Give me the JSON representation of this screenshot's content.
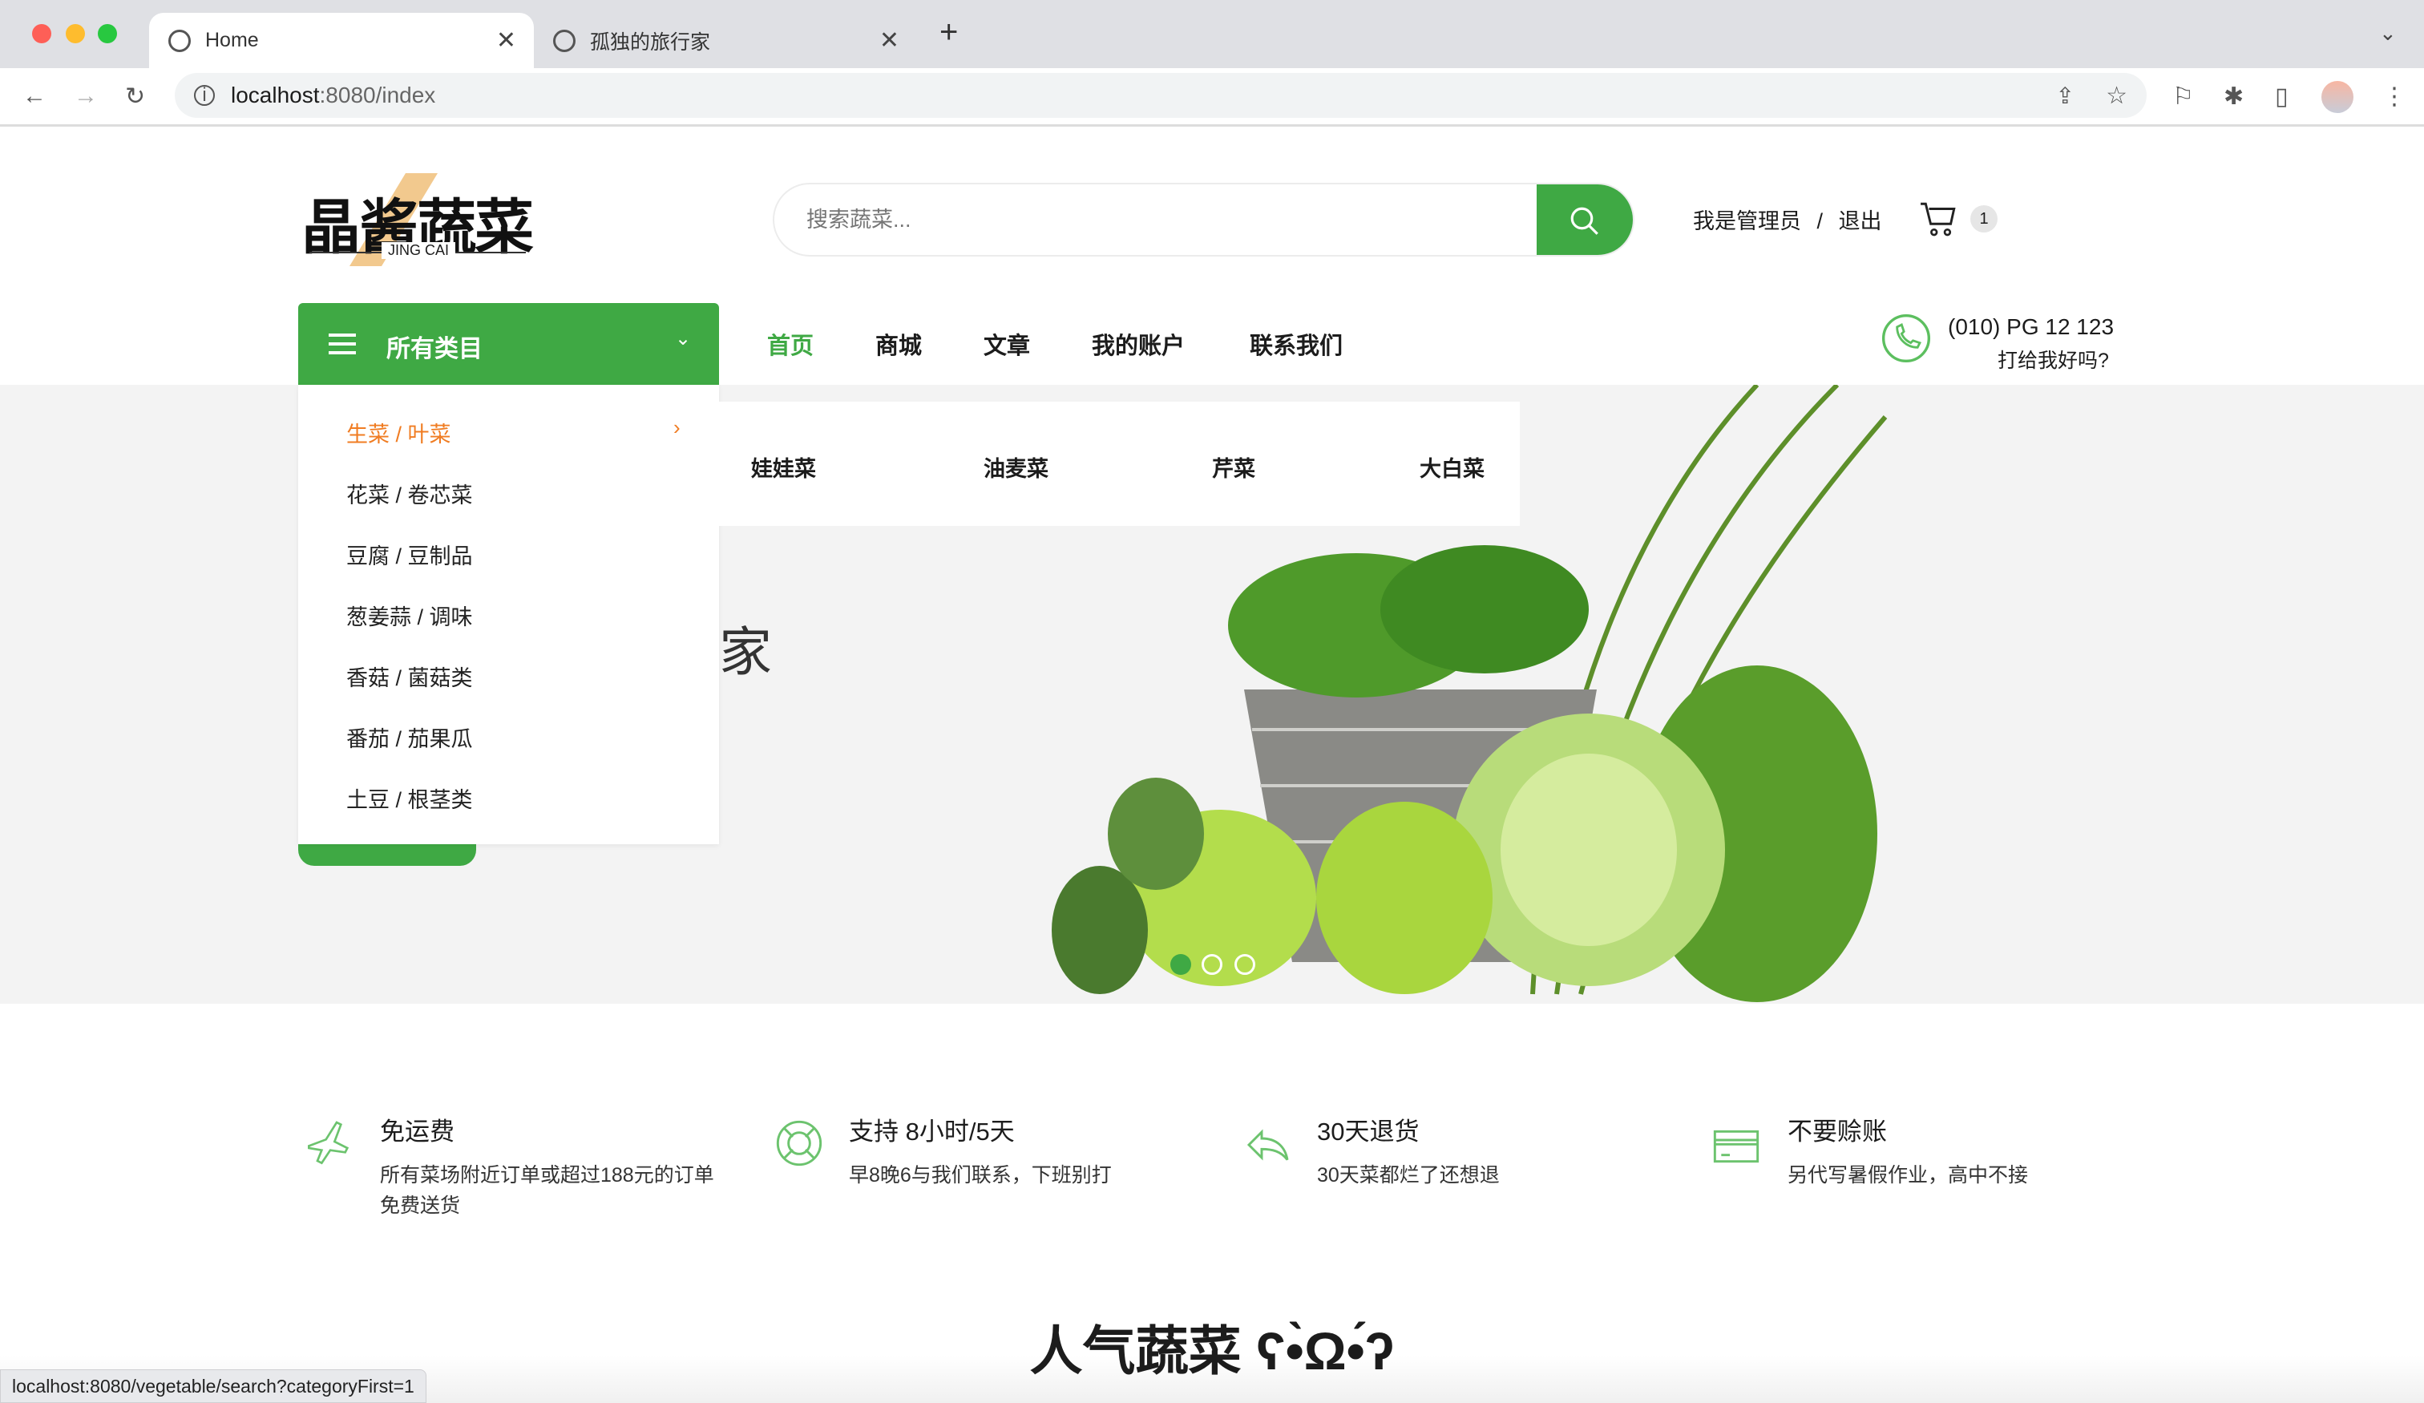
{
  "browser": {
    "tabs": [
      {
        "title": "Home",
        "active": true
      },
      {
        "title": "孤独的旅行家",
        "active": false
      }
    ],
    "url_host": "localhost",
    "url_rest": ":8080/index",
    "status_url": "localhost:8080/vegetable/search?categoryFirst=1"
  },
  "header": {
    "logo_text": "晶酱蔬菜",
    "logo_sub": "JING CAI",
    "search_placeholder": "搜索蔬菜...",
    "user_text": "我是管理员",
    "sep": "/",
    "logout": "退出",
    "cart_count": "1"
  },
  "nav": {
    "category_label": "所有类目",
    "items": [
      "首页",
      "商城",
      "文章",
      "我的账户",
      "联系我们"
    ],
    "active": "首页",
    "phone": "(010) PG 12 123",
    "phone_sub": "打给我好吗?"
  },
  "categories": [
    "生菜 / 叶菜",
    "花菜 / 卷芯菜",
    "豆腐 / 豆制品",
    "葱姜蒜 / 调味",
    "香菇 / 菌菇类",
    "番茄 / 茄果瓜",
    "土豆 / 根茎类"
  ],
  "subcategories": [
    "娃娃菜",
    "油麦菜",
    "芹菜",
    "大白菜"
  ],
  "hero": {
    "partial_text": "家",
    "slides": 3,
    "active_slide": 1
  },
  "features": [
    {
      "icon": "plane-icon",
      "title": "免运费",
      "desc": "所有菜场附近订单或超过188元的订单免费送货"
    },
    {
      "icon": "lifebuoy-icon",
      "title": "支持 8小时/5天",
      "desc": "早8晚6与我们联系，下班别打"
    },
    {
      "icon": "return-icon",
      "title": "30天退货",
      "desc": "30天菜都烂了还想退"
    },
    {
      "icon": "credit-card-icon",
      "title": "不要赊账",
      "desc": "另代写暑假作业，高中不接"
    }
  ],
  "section_title": "人气蔬菜 ʕ•̀Ω•́ʔ",
  "colors": {
    "accent": "#3fa944",
    "highlight": "#f07c22"
  }
}
